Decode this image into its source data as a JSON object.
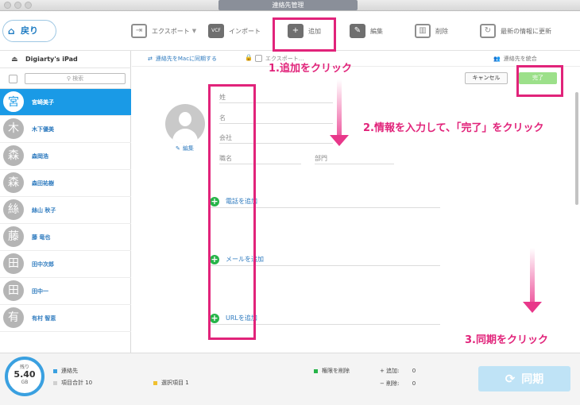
{
  "window": {
    "title": "連絡先管理"
  },
  "toolbar": {
    "back_label": "戻り",
    "export_label": "エクスポート",
    "import_label": "インポート",
    "add_label": "追加",
    "edit_label": "編集",
    "delete_label": "削除",
    "refresh_label": "最新の情報に更新",
    "import_icon_text": "VCF"
  },
  "sidebar": {
    "device_name": "Digiarty's iPad",
    "search_placeholder": "検索",
    "contacts": [
      {
        "initial": "宮",
        "name": "宮崎美子"
      },
      {
        "initial": "木",
        "name": "木下優美"
      },
      {
        "initial": "森",
        "name": "森岡浩"
      },
      {
        "initial": "森",
        "name": "森田祐樹"
      },
      {
        "initial": "絲",
        "name": "絲山 秋子"
      },
      {
        "initial": "藤",
        "name": "藤 竜也"
      },
      {
        "initial": "田",
        "name": "田中次郎"
      },
      {
        "initial": "田",
        "name": "田中一"
      },
      {
        "initial": "有",
        "name": "有村 智恵"
      }
    ]
  },
  "main": {
    "sync_to_mac": "連絡先をMacに同期する",
    "export_partial": "エクスポート...",
    "merge_label": "連絡先を統合",
    "cancel_label": "キャンセル",
    "done_label": "完了",
    "edit_photo_label": "編集",
    "fields": {
      "last_name": "姓",
      "first_name": "名",
      "company": "会社",
      "job_title": "職名",
      "department": "部門"
    },
    "add_phone": "電話を追加",
    "add_email": "メールを追加",
    "add_url": "URLを追加"
  },
  "annotations": {
    "step1": "1.追加をクリック",
    "step2": "2.情報を入力して、「完了」をクリック",
    "step3": "3.同期をクリック"
  },
  "footer": {
    "remaining_label": "残り",
    "storage_value": "5.40",
    "storage_unit": "GB",
    "contacts_label": "連絡先",
    "items_total": "項目合計 10",
    "selected_items": "選択項目 1",
    "delete_permission": "権限を削除",
    "added_label": "追加:",
    "added_count": "0",
    "deleted_label": "削除:",
    "deleted_count": "0",
    "sync_label": "同期"
  },
  "colors": {
    "accent": "#1a9ae6",
    "annotation": "#e1237a",
    "done_button": "#9ce08a",
    "add_green": "#27b449"
  }
}
